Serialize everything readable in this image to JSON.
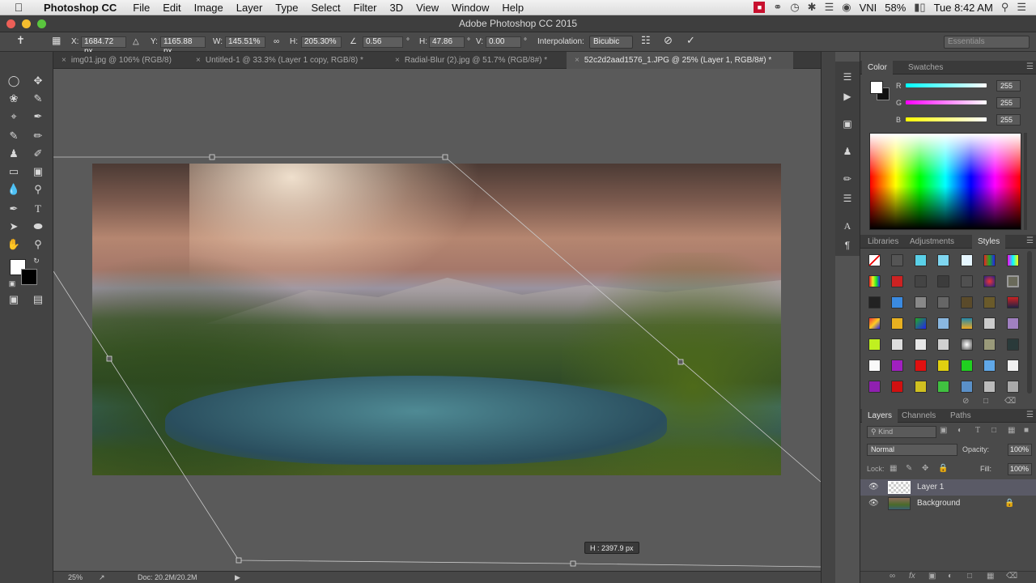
{
  "menubar": {
    "app_name": "Photoshop CC",
    "items": [
      "File",
      "Edit",
      "Image",
      "Layer",
      "Type",
      "Select",
      "Filter",
      "3D",
      "View",
      "Window",
      "Help"
    ],
    "input_source": "VNI",
    "battery": "58%",
    "clock": "Tue 8:42 AM"
  },
  "window": {
    "title": "Adobe Photoshop CC 2015"
  },
  "options": {
    "x_label": "X:",
    "x_value": "1684.72 px",
    "y_label": "Y:",
    "y_value": "1165.88 px",
    "w_label": "W:",
    "w_value": "145.51%",
    "h_label": "H:",
    "h_value": "205.30%",
    "angle_value": "0.56",
    "hskew_label": "H:",
    "hskew_value": "47.86",
    "vskew_label": "V:",
    "vskew_value": "0.00",
    "interp_label": "Interpolation:",
    "interp_value": "Bicubic",
    "workspace": "Essentials"
  },
  "tabs": [
    {
      "label": "img01.jpg @ 106% (RGB/8)",
      "active": false
    },
    {
      "label": "Untitled-1 @ 33.3% (Layer 1 copy, RGB/8) *",
      "active": false
    },
    {
      "label": "Radial-Blur (2).jpg @ 51.7% (RGB/8#) *",
      "active": false
    },
    {
      "label": "52c2d2aad1576_1.JPG @ 25% (Layer 1, RGB/8#) *",
      "active": true
    }
  ],
  "canvas": {
    "height_readout": "H : 2397.9 px"
  },
  "status": {
    "zoom": "25%",
    "doc": "Doc: 20.2M/20.2M"
  },
  "color_panel": {
    "tabs": [
      "Color",
      "Swatches"
    ],
    "r_label": "R",
    "r_value": "255",
    "g_label": "G",
    "g_value": "255",
    "b_label": "B",
    "b_value": "255"
  },
  "styles_panel": {
    "tabs": [
      "Libraries",
      "Adjustments",
      "Styles"
    ]
  },
  "layers_panel": {
    "tabs": [
      "Layers",
      "Channels",
      "Paths"
    ],
    "kind_placeholder": "Kind",
    "blend_mode": "Normal",
    "opacity_label": "Opacity:",
    "opacity_value": "100%",
    "lock_label": "Lock:",
    "fill_label": "Fill:",
    "fill_value": "100%",
    "layers": [
      {
        "name": "Layer 1",
        "selected": true
      },
      {
        "name": "Background",
        "selected": false
      }
    ]
  },
  "colors": {
    "accent": "#5a5a66",
    "canvas_bg": "#5a5a5a",
    "panel_bg": "#4a4a4a"
  }
}
